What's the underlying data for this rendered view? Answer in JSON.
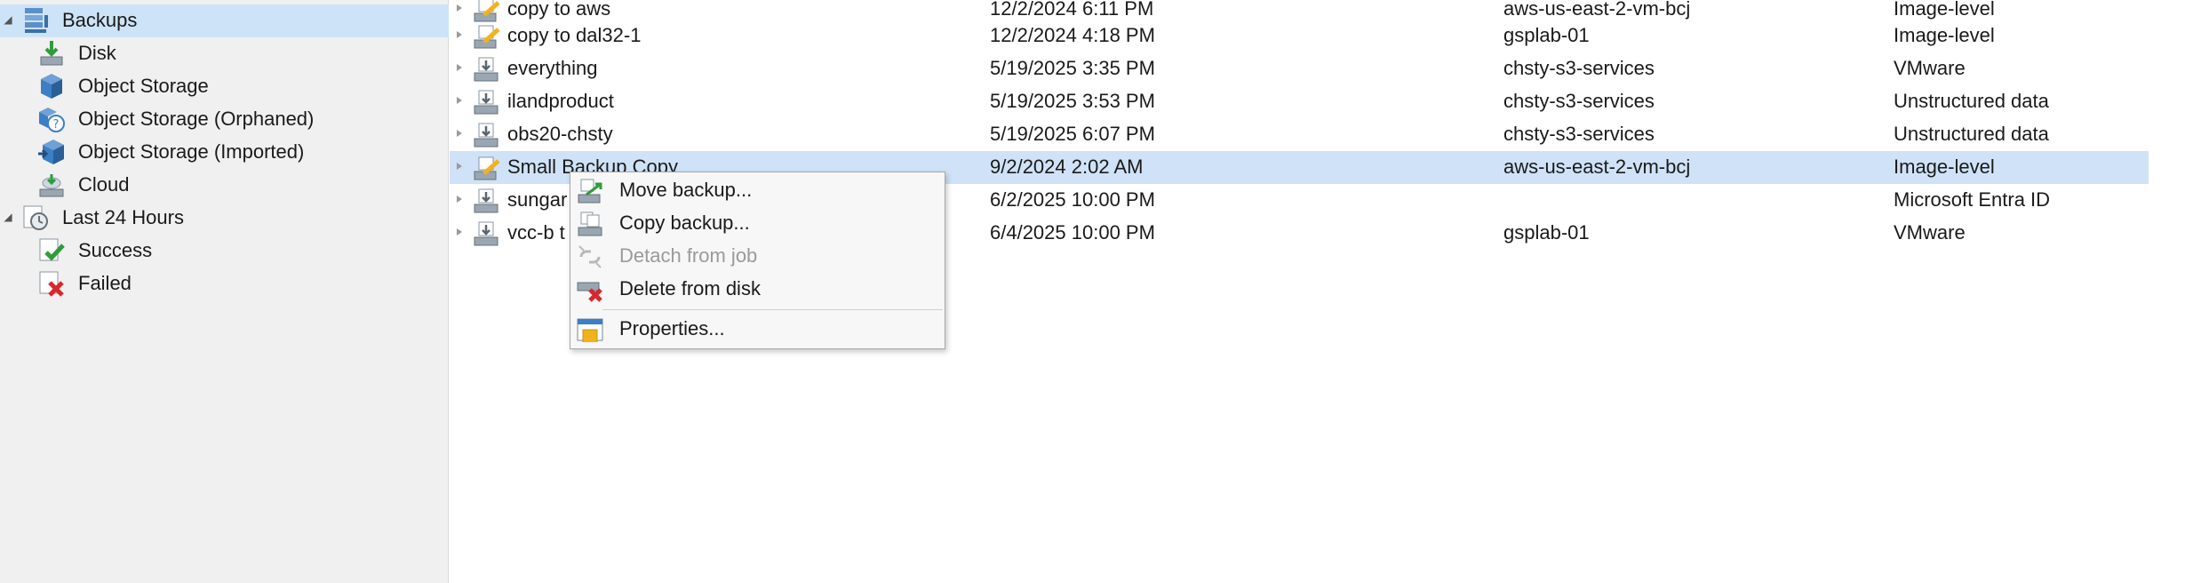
{
  "sidebar": {
    "items": [
      {
        "label": "Backups",
        "icon": "backups-icon",
        "expander": "collapse"
      },
      {
        "label": "Disk",
        "icon": "disk-icon"
      },
      {
        "label": "Object Storage",
        "icon": "object-storage-icon"
      },
      {
        "label": "Object Storage (Orphaned)",
        "icon": "object-storage-orphaned-icon"
      },
      {
        "label": "Object Storage (Imported)",
        "icon": "object-storage-imported-icon"
      },
      {
        "label": "Cloud",
        "icon": "cloud-icon"
      },
      {
        "label": "Last 24 Hours",
        "icon": "last-24-hours-icon",
        "expander": "collapse"
      },
      {
        "label": "Success",
        "icon": "success-icon"
      },
      {
        "label": "Failed",
        "icon": "failed-icon"
      }
    ]
  },
  "list": {
    "rows": [
      {
        "name": "copy to aws",
        "date": "12/2/2024 6:11 PM",
        "repository": "aws-us-east-2-vm-bcj",
        "type": "Image-level",
        "icon": "backup-copy-icon"
      },
      {
        "name": "copy to dal32-1",
        "date": "12/2/2024 4:18 PM",
        "repository": "gsplab-01",
        "type": "Image-level",
        "icon": "backup-copy-icon"
      },
      {
        "name": "everything",
        "date": "5/19/2025 3:35 PM",
        "repository": "chsty-s3-services",
        "type": "VMware",
        "icon": "backup-job-icon"
      },
      {
        "name": "ilandproduct",
        "date": "5/19/2025 3:53 PM",
        "repository": "chsty-s3-services",
        "type": "Unstructured data",
        "icon": "backup-job-icon"
      },
      {
        "name": "obs20-chsty",
        "date": "5/19/2025 6:07 PM",
        "repository": "chsty-s3-services",
        "type": "Unstructured data",
        "icon": "backup-job-icon"
      },
      {
        "name": "Small Backup Copy",
        "date": "9/2/2024 2:02 AM",
        "repository": "aws-us-east-2-vm-bcj",
        "type": "Image-level",
        "icon": "backup-copy-icon",
        "selected": true
      },
      {
        "name": "sungar",
        "date": "6/2/2025 10:00 PM",
        "repository": "",
        "type": "Microsoft Entra ID",
        "icon": "backup-job-icon"
      },
      {
        "name": "vcc-b t",
        "date": "6/4/2025 10:00 PM",
        "repository": "gsplab-01",
        "type": "VMware",
        "icon": "backup-job-icon"
      }
    ]
  },
  "context_menu": {
    "items": [
      {
        "label": "Move backup...",
        "icon": "move-backup-icon",
        "enabled": true
      },
      {
        "label": "Copy backup...",
        "icon": "copy-backup-icon",
        "enabled": true
      },
      {
        "label": "Detach from job",
        "icon": "detach-icon",
        "enabled": false
      },
      {
        "label": "Delete from disk",
        "icon": "delete-from-disk-icon",
        "enabled": true
      },
      {
        "label": "Properties...",
        "icon": "properties-icon",
        "enabled": true
      }
    ]
  },
  "colors": {
    "selection": "#cfe2f8",
    "sidebar_bg": "#f0f0f0",
    "accent_blue": "#3b7fc4",
    "success_green": "#2e9d3a",
    "failed_red": "#d9262c",
    "copy_yellow": "#f2b21c"
  }
}
